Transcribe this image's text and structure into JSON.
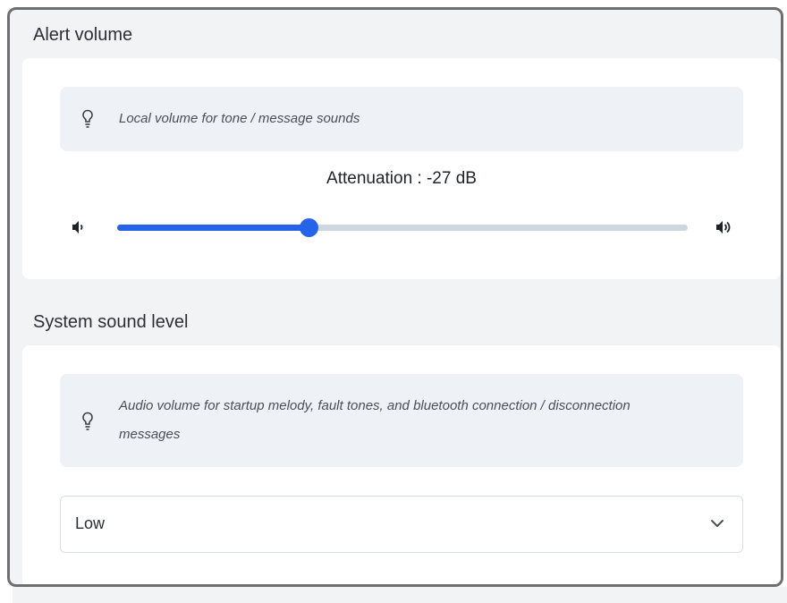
{
  "alert_volume": {
    "title": "Alert volume",
    "hint": "Local volume for tone / message sounds",
    "attenuation_label": "Attenuation : -27 dB",
    "slider_fraction": 0.335
  },
  "system_sound": {
    "title": "System sound level",
    "hint": "Audio volume for startup melody, fault tones, and bluetooth connection / disconnection messages",
    "select_value": "Low"
  },
  "colors": {
    "accent": "#2563eb",
    "track": "#cfd6e0",
    "hint_bg": "#eef1f6",
    "panel_bg": "#f2f3f5"
  },
  "icons": {
    "hint": "lightbulb-icon",
    "volume_low": "volume-low-icon",
    "volume_high": "volume-high-icon",
    "dropdown": "chevron-down-icon"
  }
}
